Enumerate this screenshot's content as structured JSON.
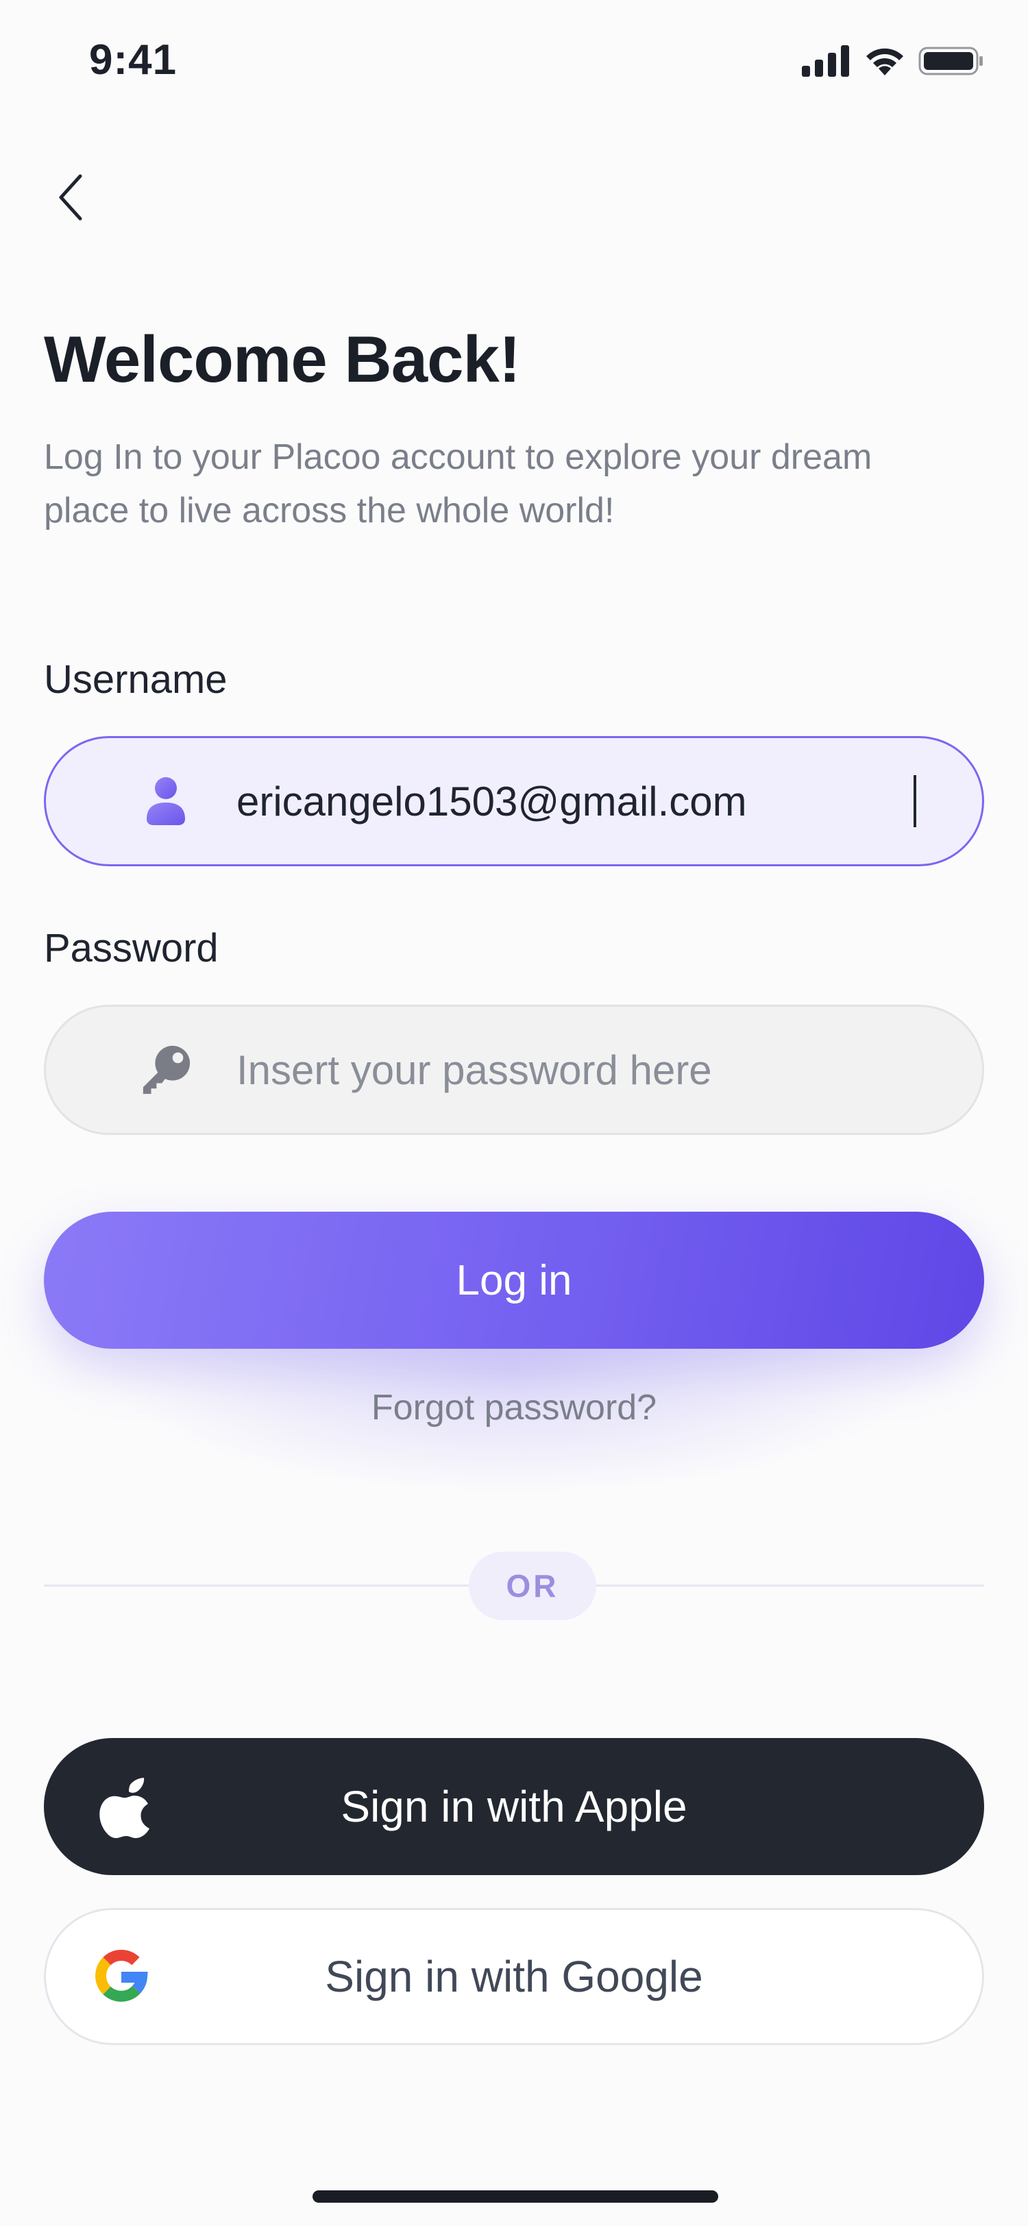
{
  "status_bar": {
    "time": "9:41",
    "icons": [
      "signal-icon",
      "wifi-icon",
      "battery-icon"
    ]
  },
  "nav": {
    "back_icon": "chevron-left-icon"
  },
  "header": {
    "title": "Welcome Back!",
    "subtitle": "Log In to your Placoo account to explore your dream place to live across the whole world!"
  },
  "form": {
    "username": {
      "label": "Username",
      "value": "ericangelo1503@gmail.com",
      "icon": "user-icon"
    },
    "password": {
      "label": "Password",
      "placeholder": "Insert your password here",
      "icon": "key-icon"
    },
    "login_label": "Log in",
    "forgot_label": "Forgot password?"
  },
  "divider": {
    "text": "OR"
  },
  "social": {
    "apple_label": "Sign in with Apple",
    "google_label": "Sign in with Google"
  },
  "colors": {
    "accent": "#7B68EE",
    "accent_dark": "#5F47E6",
    "apple_bg": "#232730",
    "input_active_bg": "#F1EFFD",
    "background": "#FBFBFC"
  }
}
